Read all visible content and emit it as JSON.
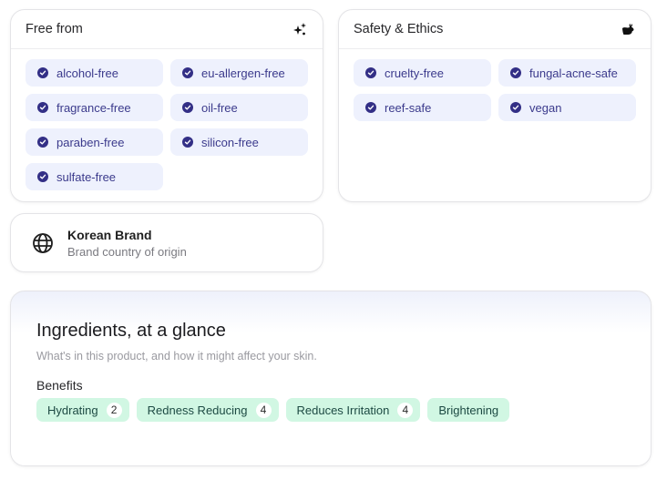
{
  "free_from": {
    "title": "Free from",
    "icon": "sparkles-icon",
    "tags": [
      {
        "label": "alcohol-free"
      },
      {
        "label": "eu-allergen-free"
      },
      {
        "label": "fragrance-free"
      },
      {
        "label": "oil-free"
      },
      {
        "label": "paraben-free"
      },
      {
        "label": "silicon-free"
      },
      {
        "label": "sulfate-free"
      }
    ]
  },
  "safety": {
    "title": "Safety & Ethics",
    "icon": "rabbit-icon",
    "tags": [
      {
        "label": "cruelty-free"
      },
      {
        "label": "fungal-acne-safe"
      },
      {
        "label": "reef-safe"
      },
      {
        "label": "vegan"
      }
    ]
  },
  "brand": {
    "icon": "globe-icon",
    "title": "Korean Brand",
    "subtitle": "Brand country of origin"
  },
  "ingredients": {
    "title": "Ingredients, at a glance",
    "subtitle": "What's in this product, and how it might affect your skin.",
    "benefits_label": "Benefits",
    "benefits": [
      {
        "label": "Hydrating",
        "count": "2"
      },
      {
        "label": "Redness Reducing",
        "count": "4"
      },
      {
        "label": "Reduces Irritation",
        "count": "4"
      },
      {
        "label": "Brightening",
        "count": null
      }
    ]
  },
  "colors": {
    "tag_bg": "#eef1fd",
    "tag_text": "#3b3a8c",
    "check": "#332f86",
    "benefit_bg": "#d1f7e3",
    "benefit_text": "#1d4a43"
  }
}
